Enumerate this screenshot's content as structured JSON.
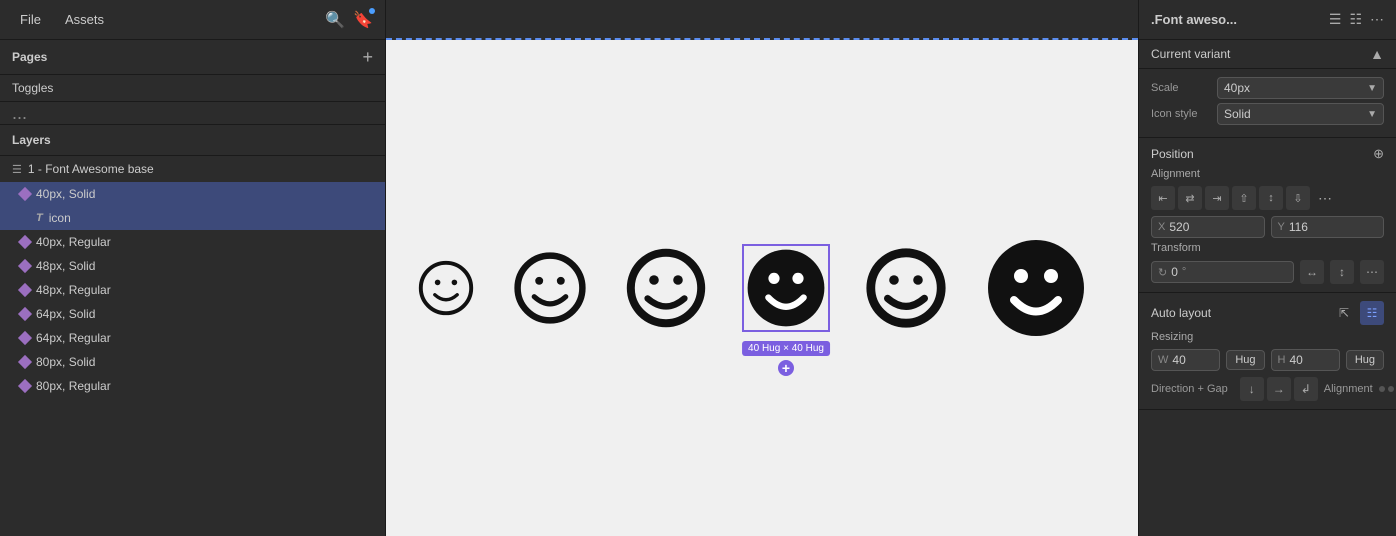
{
  "topbar": {
    "file_label": "File",
    "assets_label": "Assets"
  },
  "pages": {
    "title": "Pages",
    "add_label": "+",
    "items": [
      {
        "label": "Toggles"
      },
      {
        "label": "..."
      }
    ]
  },
  "layers": {
    "title": "Layers",
    "group_name": "1 - Font Awesome base",
    "items": [
      {
        "label": "40px, Solid",
        "type": "diamond",
        "selected": true
      },
      {
        "label": "icon",
        "type": "text",
        "selected": true,
        "indent": true
      },
      {
        "label": "40px, Regular",
        "type": "diamond",
        "selected": false
      },
      {
        "label": "48px, Solid",
        "type": "diamond",
        "selected": false
      },
      {
        "label": "48px, Regular",
        "type": "diamond",
        "selected": false
      },
      {
        "label": "64px, Solid",
        "type": "diamond",
        "selected": false
      },
      {
        "label": "64px, Regular",
        "type": "diamond",
        "selected": false
      },
      {
        "label": "80px, Solid",
        "type": "diamond",
        "selected": false
      },
      {
        "label": "80px, Regular",
        "type": "diamond",
        "selected": false
      }
    ]
  },
  "canvas": {
    "smileys": [
      {
        "size": 56,
        "style": "outline-thin",
        "selected": false
      },
      {
        "size": 72,
        "style": "outline-medium",
        "selected": false
      },
      {
        "size": 72,
        "style": "outline-thick",
        "selected": false
      },
      {
        "size": 80,
        "style": "solid",
        "selected": true,
        "label": "40 Hug × 40 Hug"
      },
      {
        "size": 80,
        "style": "outline-thick",
        "selected": false
      },
      {
        "size": 100,
        "style": "solid-large",
        "selected": false
      }
    ]
  },
  "right_panel": {
    "title": ".Font aweso...",
    "sections": {
      "current_variant": "Current variant",
      "scale": {
        "label": "Scale",
        "value": "40px"
      },
      "icon_style": {
        "label": "Icon style",
        "value": "Solid"
      },
      "position": {
        "title": "Position",
        "alignment_label": "Alignment",
        "x_label": "X",
        "x_value": "520",
        "y_label": "Y",
        "y_value": "116",
        "transform_label": "Transform",
        "rotation_label": "°",
        "rotation_value": "0"
      },
      "auto_layout": {
        "title": "Auto layout",
        "resizing": {
          "label": "Resizing",
          "w_label": "W",
          "w_value": "40",
          "w_hug": "Hug",
          "h_label": "H",
          "h_value": "40",
          "h_hug": "Hug"
        },
        "direction_gap": {
          "direction_label": "Direction + Gap",
          "alignment_label": "Alignment"
        }
      }
    }
  }
}
